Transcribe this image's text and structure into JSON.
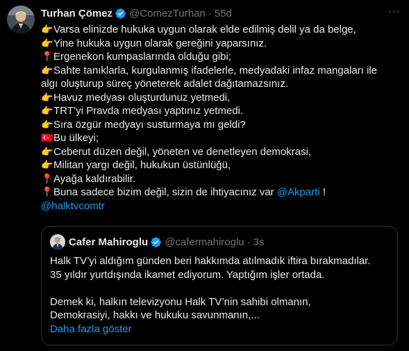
{
  "tweet": {
    "display_name": "Turhan Çömez",
    "handle": "@ComezTurhan",
    "separator": "·",
    "time": "55d",
    "more": "···",
    "lines": [
      {
        "emoji": "👉",
        "text": "Varsa elinizde hukuka uygun olarak elde edilmiş delil ya da belge,"
      },
      {
        "emoji": "👉",
        "text": "Yine hukuka uygun olarak gereğini yaparsınız."
      },
      {
        "emoji": "📍",
        "text": "Ergenekon kumpaslarında olduğu gibi;"
      },
      {
        "emoji": "👉",
        "text": "Sahte tanıklarla, kurgulanmış ifadelerle, medyadaki infaz mangaları ile"
      },
      {
        "emoji": "",
        "text": "algı oluşturup süreç yöneterek adalet dağıtamazsınız."
      },
      {
        "emoji": "👉",
        "text": "Havuz medyası oluşturdunuz yetmedi,"
      },
      {
        "emoji": "👉",
        "text": "TRT’yi Pravda medyası yaptınız yetmedi."
      },
      {
        "emoji": "👉",
        "text": "Sıra özgür medyayı susturmaya mı geldi?"
      },
      {
        "emoji": "🇹🇷",
        "text": "Bu ülkeyi;"
      },
      {
        "emoji": "👉",
        "text": "Ceberut düzen değil, yöneten ve denetleyen demokrasi,"
      },
      {
        "emoji": "👉",
        "text": "Militan yargı değil, hukukun üstünlüğü,"
      },
      {
        "emoji": "📍",
        "text": "Ayağa kaldırabilir."
      }
    ],
    "last_line": {
      "emoji": "📍",
      "text": "Buna sadece bizim değil, sizin de ihtiyacınız var ",
      "mention": "@Akparti",
      "suffix": " !"
    },
    "mention_line": "@halktvcomtr"
  },
  "quote": {
    "display_name": "Cafer Mahiroglu",
    "handle": "@cafermahiroglu",
    "separator": "·",
    "time": "3s",
    "lines_1": [
      "Halk TV’yi aldığım günden beri hakkımda atılmadık iftira bırakmadılar.",
      "35 yıldır yurtdışında ikamet ediyorum. Yaptığım işler ortada."
    ],
    "lines_2": [
      "Demek ki, halkın televizyonu Halk TV’nin sahibi olmanın,",
      "Demokrasiyi, hakkı ve hukuku savunmanın,..."
    ],
    "show_more": "Daha fazla göster"
  },
  "colors": {
    "background": "#000000",
    "text": "#e7e9ea",
    "secondary": "#71767b",
    "link": "#1d9bf0",
    "verified": "#1d9bf0",
    "border": "#2f3336"
  }
}
